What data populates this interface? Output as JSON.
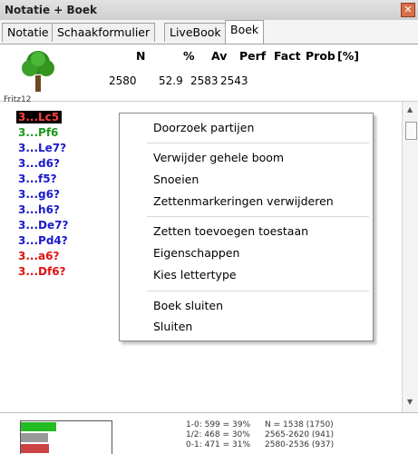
{
  "window": {
    "title": "Notatie + Boek",
    "close_glyph": "✕"
  },
  "tabs": [
    {
      "label": "Notatie"
    },
    {
      "label": "Schaakformulier"
    },
    {
      "label": "LiveBook"
    },
    {
      "label": "Boek",
      "active": true
    }
  ],
  "header": {
    "columns": [
      "N",
      "%",
      "Av",
      "Perf",
      "Fact",
      "Prob",
      "[%]"
    ],
    "values": {
      "N": "2580",
      "pct": "52.9",
      "av": "2583",
      "perf": "2543"
    },
    "engine_name": "Fritz12",
    "icon": "tree-icon"
  },
  "moves": [
    {
      "label": "3...Lc5",
      "color": "#ff4040",
      "selected": true
    },
    {
      "label": "3...Pf6",
      "color": "#1a9a1a"
    },
    {
      "label": "3...Le7?",
      "color": "#1a1acc"
    },
    {
      "label": "3...d6?",
      "color": "#1a1acc"
    },
    {
      "label": "3...f5?",
      "color": "#1a1acc"
    },
    {
      "label": "3...g6?",
      "color": "#1a1acc"
    },
    {
      "label": "3...h6?",
      "color": "#1a1acc"
    },
    {
      "label": "3...De7?",
      "color": "#1a1acc"
    },
    {
      "label": "3...Pd4?",
      "color": "#1a1acc"
    },
    {
      "label": "3...a6?",
      "color": "#e01010"
    },
    {
      "label": "3...Df6?",
      "color": "#e01010"
    }
  ],
  "context_menu": {
    "items": [
      "Doorzoek partijen",
      "Verwijder gehele boom",
      "Snoeien",
      "Zettenmarkeringen verwijderen",
      "Zetten toevoegen toestaan",
      "Eigenschappen",
      "Kies lettertype",
      "Boek sluiten",
      "Sluiten"
    ]
  },
  "footer": {
    "results": [
      "1-0: 599 = 39%",
      "1/2: 468 = 30%",
      "0-1: 471 = 31%"
    ],
    "summary": [
      "N = 1538 (1750)",
      "2565-2620 (941)",
      "2580-2536 (937)"
    ],
    "bar_colors": {
      "white_win": "#22bb22",
      "draw": "#999999",
      "black_win": "#cc4444"
    }
  }
}
